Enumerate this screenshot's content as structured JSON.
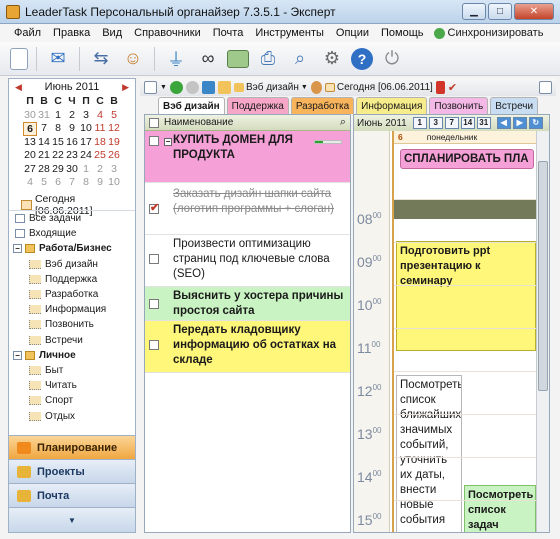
{
  "window": {
    "title": "LeaderTask Персональный органайзер 7.3.5.1 - Эксперт"
  },
  "menu": {
    "items": [
      "Файл",
      "Правка",
      "Вид",
      "Справочники",
      "Почта",
      "Инструменты",
      "Опции",
      "Помощь"
    ],
    "sync": "Синхронизировать"
  },
  "calendar": {
    "month": "Июнь 2011",
    "dow": [
      "П",
      "В",
      "С",
      "Ч",
      "П",
      "С",
      "В"
    ],
    "weeks": [
      [
        "30",
        "31",
        "1",
        "2",
        "3",
        "4",
        "5"
      ],
      [
        "6",
        "7",
        "8",
        "9",
        "10",
        "11",
        "12"
      ],
      [
        "13",
        "14",
        "15",
        "16",
        "17",
        "18",
        "19"
      ],
      [
        "20",
        "21",
        "22",
        "23",
        "24",
        "25",
        "26"
      ],
      [
        "27",
        "28",
        "29",
        "30",
        "1",
        "2",
        "3"
      ],
      [
        "4",
        "5",
        "6",
        "7",
        "8",
        "9",
        "10"
      ]
    ],
    "today_link": "Сегодня [06.06.2011]"
  },
  "tree": {
    "items": [
      {
        "label": "Все задачи",
        "type": "list",
        "level": 0
      },
      {
        "label": "Входящие",
        "type": "list",
        "level": 0
      },
      {
        "label": "Работа/Бизнес",
        "type": "folder",
        "level": 0
      },
      {
        "label": "Вэб дизайн",
        "type": "sub",
        "level": 1
      },
      {
        "label": "Поддержка",
        "type": "sub",
        "level": 1
      },
      {
        "label": "Разработка",
        "type": "sub",
        "level": 1
      },
      {
        "label": "Информация",
        "type": "sub",
        "level": 1
      },
      {
        "label": "Позвонить",
        "type": "sub",
        "level": 1
      },
      {
        "label": "Встречи",
        "type": "sub",
        "level": 1
      },
      {
        "label": "Личное",
        "type": "folder",
        "level": 0
      },
      {
        "label": "Быт",
        "type": "sub",
        "level": 1
      },
      {
        "label": "Читать",
        "type": "sub",
        "level": 1
      },
      {
        "label": "Спорт",
        "type": "sub",
        "level": 1
      },
      {
        "label": "Отдых",
        "type": "sub",
        "level": 1
      }
    ]
  },
  "nav": {
    "planning": "Планирование",
    "projects": "Проекты",
    "mail": "Почта"
  },
  "task_toolbar": {
    "category": "Вэб дизайн",
    "today": "Сегодня [06.06.2011]"
  },
  "tabs": [
    {
      "label": "Вэб дизайн",
      "color": "#ffffff"
    },
    {
      "label": "Поддержка",
      "color": "#f6a7c7"
    },
    {
      "label": "Разработка",
      "color": "#f7b45c"
    },
    {
      "label": "Информация",
      "color": "#f7ec8c"
    },
    {
      "label": "Позвонить",
      "color": "#f4b8e6"
    },
    {
      "label": "Встречи",
      "color": "#c8dcf2"
    }
  ],
  "tasklist": {
    "header": "Наименование",
    "tasks": [
      {
        "text": "КУПИТЬ ДОМЕН ДЛЯ ПРОДУКТА",
        "style": "pink",
        "progress": 0.3
      },
      {
        "text": "Заказать дизайн шапки сайта (логотип программы + слоган)",
        "style": "done"
      },
      {
        "text": "Произвести оптимизацию страниц под ключевые слова (SEO)",
        "style": "plain"
      },
      {
        "text": "Выяснить у хостера причины простоя сайта",
        "style": "green"
      },
      {
        "text": "Передать кладовщику информацию об остатках на складе",
        "style": "yellow"
      }
    ]
  },
  "dayview": {
    "month": "Июнь 2011",
    "view_buttons": [
      "1",
      "3",
      "7",
      "14",
      "31"
    ],
    "day_num": "6",
    "day_name": "понедельник",
    "hours": [
      "08",
      "09",
      "10",
      "11",
      "12",
      "13",
      "14",
      "15"
    ],
    "minutes": "00",
    "events": {
      "plan": "СПЛАНИРОВАТЬ ПЛА",
      "ppt": "Подготовить ppt презентацию к семинару",
      "list": "Посмотреть список ближайших значимых событий, уточнить их даты, внести новые события",
      "list2": "Посмотреть список задач"
    }
  }
}
